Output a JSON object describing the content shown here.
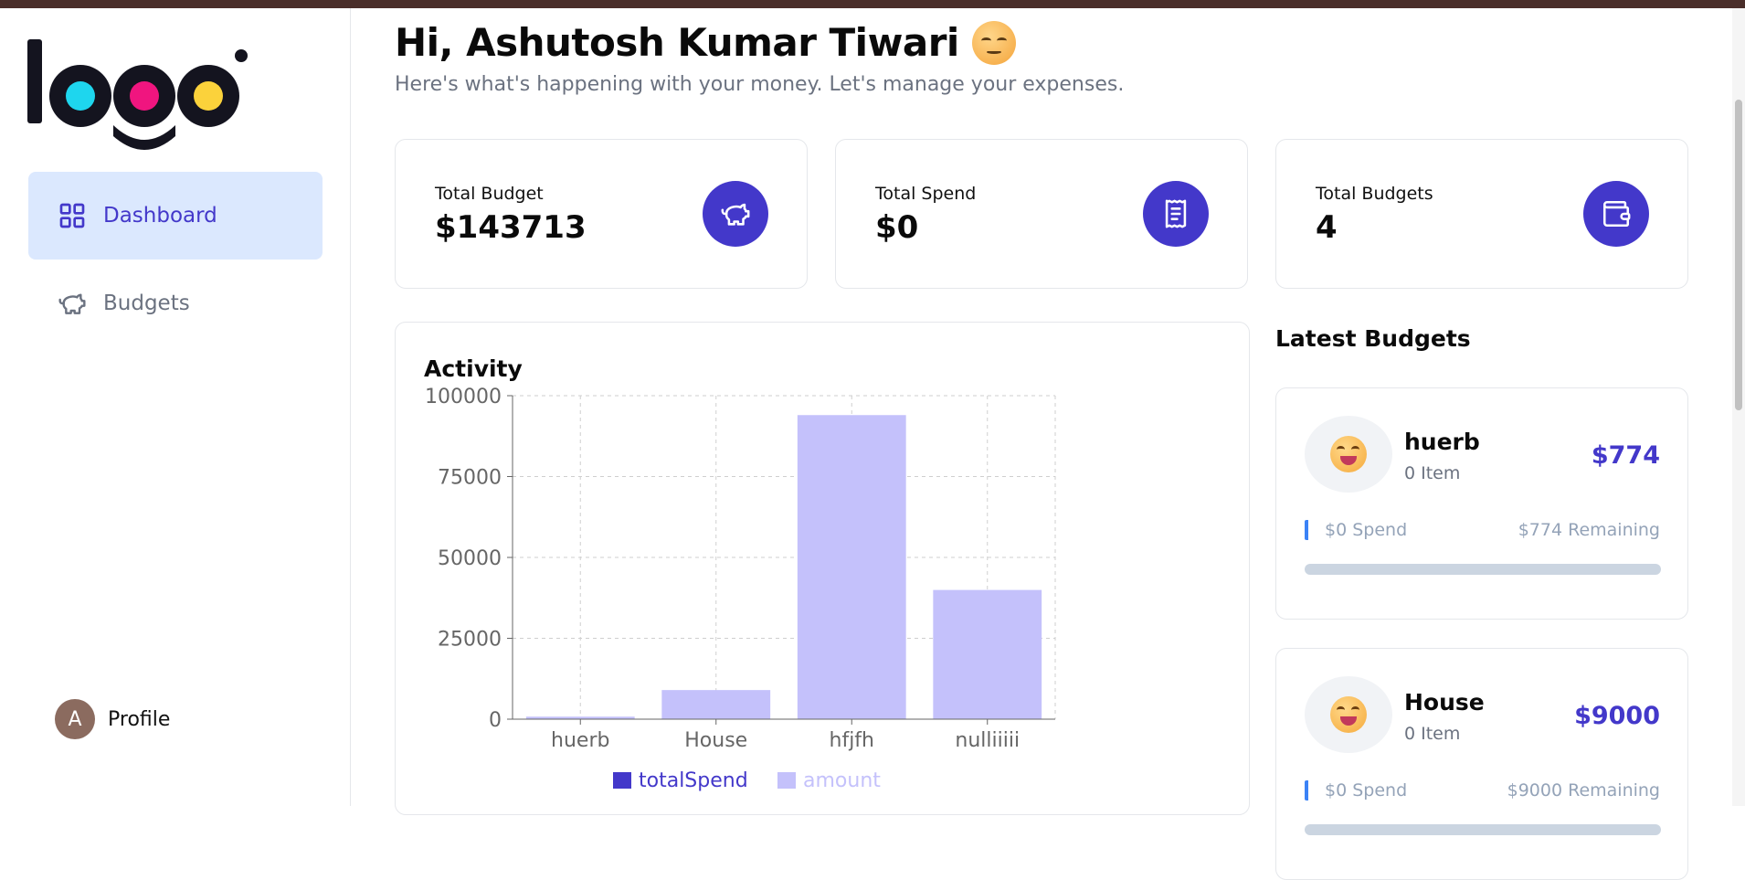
{
  "sidebar": {
    "nav": [
      {
        "label": "Dashboard",
        "icon": "dashboard-grid-icon",
        "active": true
      },
      {
        "label": "Budgets",
        "icon": "piggy-bank-icon",
        "active": false
      }
    ],
    "profile": {
      "initial": "A",
      "label": "Profile"
    }
  },
  "header": {
    "greeting": "Hi, Ashutosh Kumar Tiwari",
    "subtitle": "Here's what's happening with your money. Let's manage your expenses."
  },
  "stats": [
    {
      "label": "Total Budget",
      "value": "$143713",
      "icon": "piggy-bank-icon"
    },
    {
      "label": "Total Spend",
      "value": "$0",
      "icon": "receipt-icon"
    },
    {
      "label": "Total Budgets",
      "value": "4",
      "icon": "wallet-icon"
    }
  ],
  "activity": {
    "title": "Activity"
  },
  "chart_data": {
    "type": "bar",
    "categories": [
      "huerb",
      "House",
      "hfjfh",
      "nulliiiii"
    ],
    "series": [
      {
        "name": "totalSpend",
        "values": [
          0,
          0,
          0,
          0
        ],
        "color": "#4338ca"
      },
      {
        "name": "amount",
        "values": [
          774,
          9000,
          94000,
          39939
        ],
        "color": "#c4c1fb"
      }
    ],
    "yticks": [
      "0",
      "25000",
      "50000",
      "75000",
      "100000"
    ],
    "ylim": [
      0,
      100000
    ],
    "grid": true,
    "legend": "bottom",
    "stacked": true
  },
  "latest": {
    "title": "Latest Budgets",
    "budgets": [
      {
        "name": "huerb",
        "items": "0 Item",
        "amount": "$774",
        "spend": "$0 Spend",
        "remaining": "$774 Remaining",
        "progress": 0
      },
      {
        "name": "House",
        "items": "0 Item",
        "amount": "$9000",
        "spend": "$0 Spend",
        "remaining": "$9000 Remaining",
        "progress": 0
      }
    ]
  },
  "colors": {
    "accent": "#4338ca",
    "active_nav_bg": "#dbe8fe",
    "bar_light": "#c4c1fb"
  }
}
